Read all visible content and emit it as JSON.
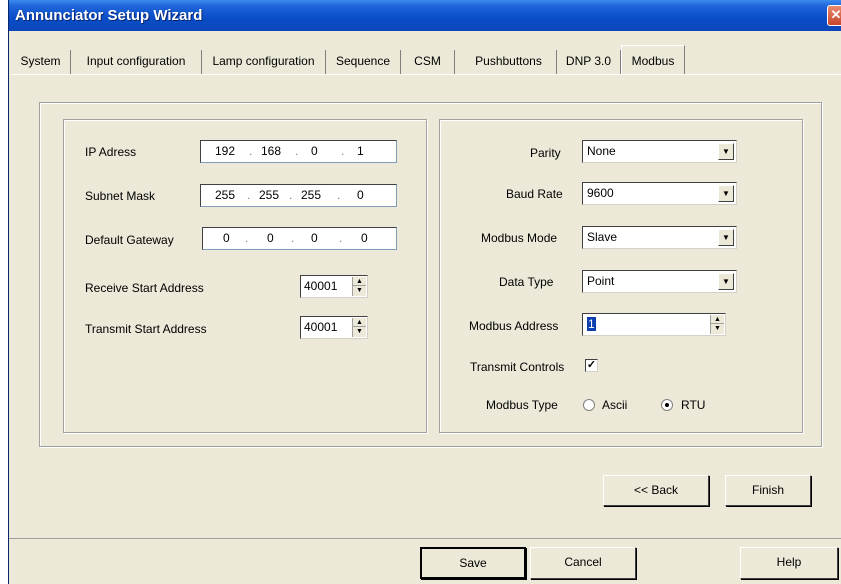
{
  "window": {
    "title": "Annunciator Setup Wizard",
    "close_glyph": "✕"
  },
  "tabs": [
    {
      "label": "System"
    },
    {
      "label": "Input configuration"
    },
    {
      "label": "Lamp configuration"
    },
    {
      "label": "Sequence"
    },
    {
      "label": "CSM"
    },
    {
      "label": "Pushbuttons"
    },
    {
      "label": "DNP 3.0"
    },
    {
      "label": "Modbus",
      "active": true
    }
  ],
  "network": {
    "ip_label": "IP Adress",
    "ip": [
      "192",
      "168",
      "0",
      "1"
    ],
    "subnet_label": "Subnet Mask",
    "subnet": [
      "255",
      "255",
      "255",
      "0"
    ],
    "gateway_label": "Default Gateway",
    "gateway": [
      "0",
      "0",
      "0",
      "0"
    ],
    "receive_label": "Receive Start Address",
    "receive_value": "40001",
    "transmit_label": "Transmit Start Address",
    "transmit_value": "40001"
  },
  "serial": {
    "parity_label": "Parity",
    "parity_value": "None",
    "baud_label": "Baud Rate",
    "baud_value": "9600",
    "mode_label": "Modbus Mode",
    "mode_value": "Slave",
    "datatype_label": "Data Type",
    "datatype_value": "Point",
    "address_label": "Modbus Address",
    "address_value": "1",
    "transmit_controls_label": "Transmit Controls",
    "transmit_controls_checked": true,
    "modbus_type_label": "Modbus Type",
    "type_ascii_label": "Ascii",
    "type_rtu_label": "RTU",
    "type_selected": "RTU"
  },
  "wizard_buttons": {
    "back_label": "<< Back",
    "finish_label": "Finish"
  },
  "footer_buttons": {
    "save_label": "Save",
    "cancel_label": "Cancel",
    "help_label": "Help"
  },
  "glyphs": {
    "check": "✓",
    "dropdown": "▼",
    "spin_up": "▲",
    "spin_down": "▼"
  }
}
